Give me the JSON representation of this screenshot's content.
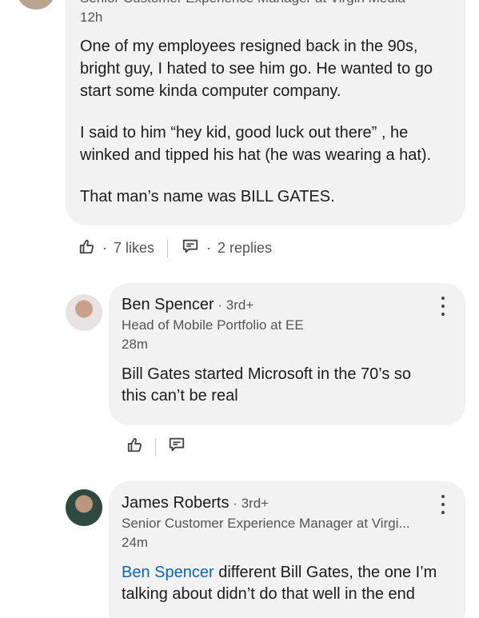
{
  "top_comment": {
    "author_headline_partial": "Senior Customer Experience Manager at Virgin Media",
    "time": "12h",
    "paragraphs": [
      [
        "One of my employees resigned back in the 90s,",
        "bright guy, I hated to see him go. He wanted to go",
        "start some kinda computer company."
      ],
      [
        "I said to him “hey kid, good luck out there” , he",
        "winked and tipped his hat (he was wearing a hat)."
      ],
      [
        "That man’s name was BILL GATES."
      ]
    ],
    "likes_separator": "·",
    "likes": "7 likes",
    "replies_separator": "·",
    "replies": "2 replies"
  },
  "reply_1": {
    "name": "Ben Spencer",
    "degree": " · 3rd+",
    "headline": "Head of Mobile Portfolio at EE",
    "time": "28m",
    "lines": [
      "Bill Gates started Microsoft in the 70’s so",
      "this can’t be real"
    ]
  },
  "reply_2": {
    "name": "James Roberts",
    "degree": " · 3rd+",
    "headline": "Senior Customer Experience Manager at Virgi...",
    "time": "24m",
    "mention": "Ben Spencer",
    "line1_rest": " different Bill Gates, the one I’m",
    "line2": "talking about didn’t do that well in the end"
  },
  "icons": {
    "like": "thumbs-up-icon",
    "reply": "comment-icon",
    "more": "more-vertical-icon"
  }
}
